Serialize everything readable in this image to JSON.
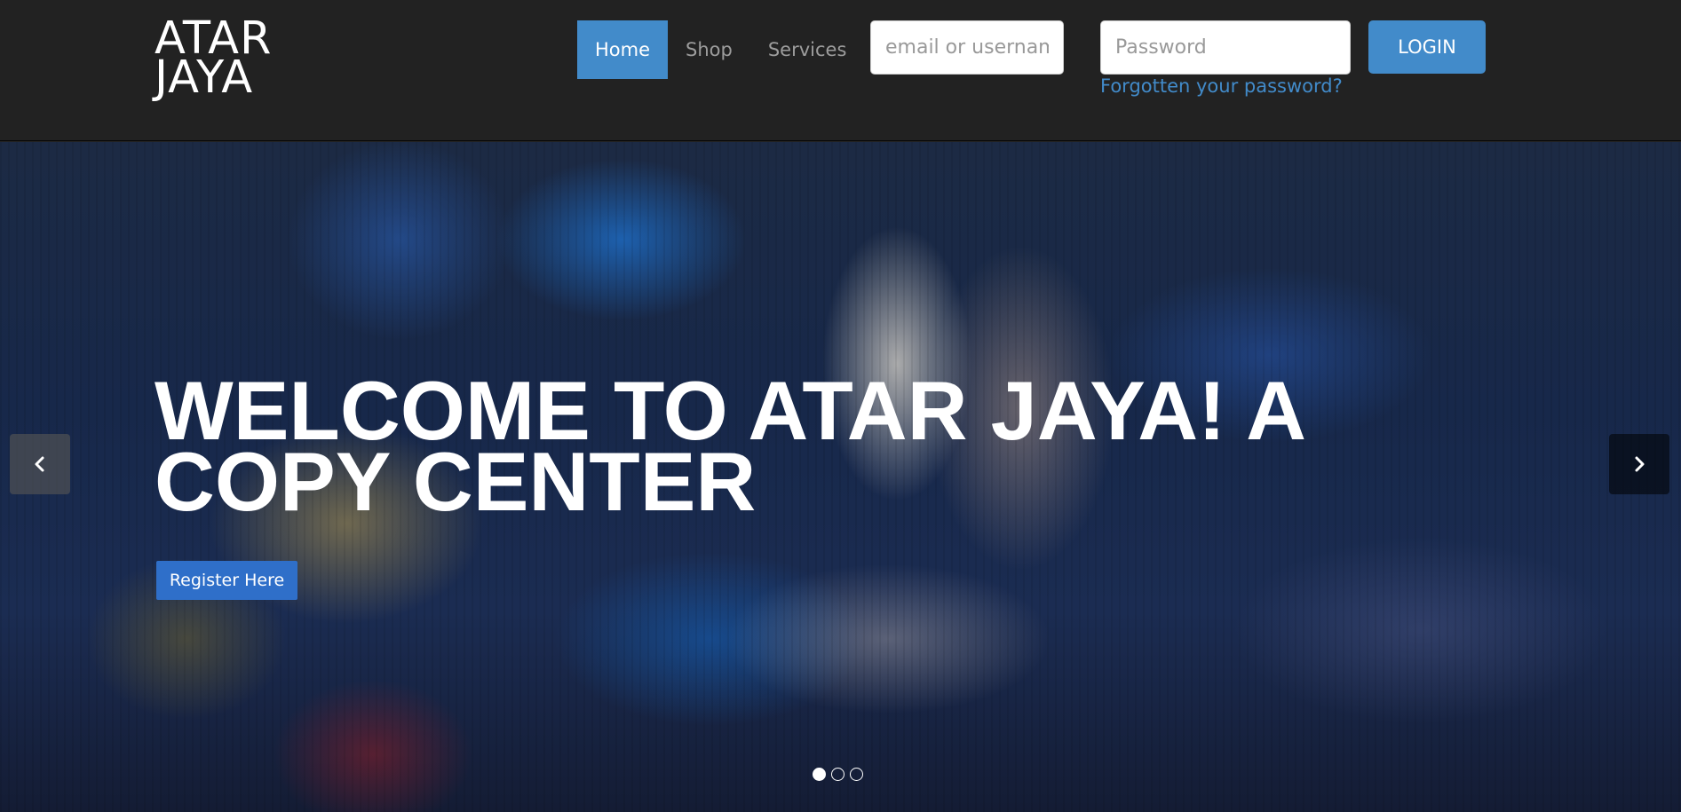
{
  "header": {
    "brand_line1": "ATAR",
    "brand_line2": "JAYA",
    "nav": [
      {
        "label": "Home",
        "active": true
      },
      {
        "label": "Shop",
        "active": false
      },
      {
        "label": "Services",
        "active": false
      }
    ],
    "login": {
      "email_placeholder": "email or username",
      "email_value": "",
      "password_placeholder": "Password",
      "password_value": "",
      "button_label": "LOGIN",
      "forgot_label": "Forgotten your password?"
    }
  },
  "hero": {
    "heading": "WELCOME TO ATAR JAYA! A COPY CENTER",
    "cta_label": "Register Here",
    "prev_icon": "chevron-left-icon",
    "next_icon": "chevron-right-icon",
    "slide_count": 3,
    "active_slide": 1
  },
  "colors": {
    "navbar_bg": "#222222",
    "accent": "#428bca",
    "cta": "#2f6fc9",
    "nav_text": "#9d9d9d"
  }
}
